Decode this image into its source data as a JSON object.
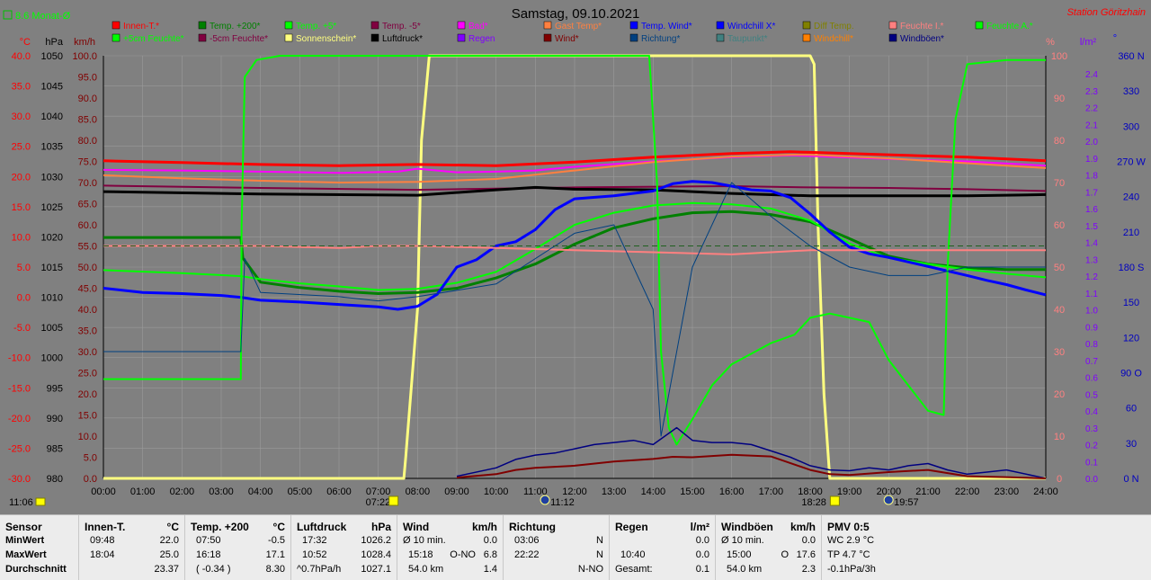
{
  "title": "Samstag, 09.10.2021",
  "station": "Station Göritzhain",
  "month_avg": "8.6 Monat-Ø",
  "axis_units": {
    "c": "°C",
    "hpa": "hPa",
    "kmh": "km/h",
    "pct": "%",
    "lm2": "l/m²",
    "deg": "°"
  },
  "legend": [
    {
      "label": "Innen-T.*",
      "color": "#ff0000"
    },
    {
      "label": "Temp. +200*",
      "color": "#008000"
    },
    {
      "label": "Temp. +5*",
      "color": "#00ff00"
    },
    {
      "label": "Temp. -5*",
      "color": "#800040"
    },
    {
      "label": "Bad*",
      "color": "#ff00ff"
    },
    {
      "label": "Gast Temp*",
      "color": "#ff8040"
    },
    {
      "label": "Temp. Wind*",
      "color": "#0000ff"
    },
    {
      "label": "Windchill X*",
      "color": "#0000ff"
    },
    {
      "label": "Diff Temp.",
      "color": "#808000"
    },
    {
      "label": "Feuchte I.*",
      "color": "#ff8080"
    },
    {
      "label": "Feuchte A.*",
      "color": "#00ff00"
    },
    {
      "label": "+5cm Feuchte*",
      "color": "#00ff00"
    },
    {
      "label": "-5cm Feuchte*",
      "color": "#800040"
    },
    {
      "label": "Sonnenschein*",
      "color": "#ffff80"
    },
    {
      "label": "Luftdruck*",
      "color": "#000000"
    },
    {
      "label": "Regen",
      "color": "#8000ff"
    },
    {
      "label": "Wind*",
      "color": "#800000"
    },
    {
      "label": "Richtung*",
      "color": "#004080"
    },
    {
      "label": "Taupunkt*",
      "color": "#408080"
    },
    {
      "label": "Windchill*",
      "color": "#ff8000"
    },
    {
      "label": "Windböen*",
      "color": "#000080"
    }
  ],
  "chart_data": {
    "type": "line",
    "title": "Samstag, 09.10.2021",
    "x_ticks": [
      "00:00",
      "01:00",
      "02:00",
      "03:00",
      "04:00",
      "05:00",
      "06:00",
      "07:00",
      "08:00",
      "09:00",
      "10:00",
      "11:00",
      "12:00",
      "13:00",
      "14:00",
      "15:00",
      "16:00",
      "17:00",
      "18:00",
      "19:00",
      "20:00",
      "21:00",
      "22:00",
      "23:00",
      "24:00"
    ],
    "y_axes": {
      "temp_c": [
        "40.0",
        "35.0",
        "30.0",
        "25.0",
        "20.0",
        "15.0",
        "10.0",
        "5.0",
        "0.0",
        "-5.0",
        "-10.0",
        "-15.0",
        "-20.0",
        "-25.0",
        "-30.0"
      ],
      "pressure_hpa": [
        "1050",
        "1045",
        "1040",
        "1035",
        "1030",
        "1025",
        "1020",
        "1015",
        "1010",
        "1005",
        "1000",
        "995",
        "990",
        "985",
        "980"
      ],
      "wind_kmh": [
        "100.0",
        "95.0",
        "90.0",
        "85.0",
        "80.0",
        "75.0",
        "70.0",
        "65.0",
        "60.0",
        "55.0",
        "50.0",
        "45.0",
        "40.0",
        "35.0",
        "30.0",
        "25.0",
        "20.0",
        "15.0",
        "10.0",
        "5.0",
        "0.0"
      ],
      "humidity_pct": [
        "100",
        "90",
        "80",
        "70",
        "60",
        "50",
        "40",
        "30",
        "20",
        "10",
        "0"
      ],
      "rain_lm2": [
        "2.4",
        "2.3",
        "2.2",
        "2.1",
        "2.0",
        "1.9",
        "1.8",
        "1.7",
        "1.6",
        "1.5",
        "1.4",
        "1.3",
        "1.2",
        "1.1",
        "1.0",
        "0.9",
        "0.8",
        "0.7",
        "0.6",
        "0.5",
        "0.4",
        "0.3",
        "0.2",
        "0.1",
        "0.0"
      ],
      "direction_deg": [
        "360 N",
        "330",
        "300",
        "270 W",
        "240",
        "210",
        "180 S",
        "150",
        "120",
        "90 O",
        "60",
        "30",
        "0 N"
      ]
    },
    "temp_range": [
      -30,
      40
    ],
    "pct_range": [
      0,
      100
    ],
    "series": [
      {
        "name": "Innen-T.*",
        "color": "#ff0000",
        "width": 3,
        "axis": "temp",
        "x": [
          0,
          2,
          4,
          6,
          8,
          10,
          12,
          14,
          16,
          17.5,
          18,
          20,
          22,
          24
        ],
        "y": [
          22.6,
          22.3,
          22.0,
          21.8,
          22.0,
          21.8,
          22.4,
          23.2,
          23.8,
          24.1,
          24.0,
          23.6,
          23.2,
          22.6
        ]
      },
      {
        "name": "Bad*",
        "color": "#ff00ff",
        "width": 2,
        "axis": "temp",
        "x": [
          0,
          2,
          4,
          6,
          7.5,
          8,
          9,
          10,
          11,
          12,
          14,
          16,
          17.5,
          18,
          20,
          22,
          24
        ],
        "y": [
          21.1,
          21.0,
          20.8,
          20.6,
          20.8,
          21.3,
          20.7,
          20.8,
          21.0,
          21.6,
          22.5,
          23.2,
          23.5,
          23.4,
          22.9,
          22.5,
          21.8
        ]
      },
      {
        "name": "Gast Temp*",
        "color": "#ff8040",
        "width": 2,
        "axis": "temp",
        "x": [
          0,
          2,
          4,
          6,
          8,
          10,
          12,
          14,
          16,
          17.5,
          18,
          20,
          22,
          24
        ],
        "y": [
          20.2,
          19.7,
          19.3,
          19.0,
          19.1,
          19.6,
          21.0,
          22.4,
          23.3,
          23.6,
          23.6,
          23.0,
          22.2,
          21.4
        ]
      },
      {
        "name": "Temp. -5*",
        "color": "#800040",
        "width": 2,
        "axis": "temp",
        "x": [
          0,
          4,
          8,
          12,
          16,
          18,
          20,
          22,
          24
        ],
        "y": [
          18.5,
          18.1,
          17.8,
          18.2,
          18.4,
          18.2,
          18.1,
          17.9,
          17.6
        ]
      },
      {
        "name": "Luftdruck*",
        "color": "#000000",
        "width": 3,
        "axis": "temp",
        "x": [
          0,
          4,
          8,
          10,
          11,
          12,
          14,
          16,
          18,
          20,
          22,
          24
        ],
        "y": [
          17.5,
          17.1,
          16.9,
          17.8,
          18.2,
          17.9,
          17.8,
          17.2,
          16.8,
          16.8,
          16.8,
          17.0
        ]
      },
      {
        "name": "Temp. +200*",
        "color": "#008000",
        "width": 3,
        "axis": "temp",
        "x": [
          0,
          3.5,
          3.55,
          4,
          5,
          6,
          7,
          8,
          9,
          10,
          11,
          12,
          13,
          14,
          15,
          16,
          17,
          18,
          19,
          20,
          21,
          22,
          23,
          24
        ],
        "y": [
          9.9,
          9.9,
          6.5,
          2.5,
          1.6,
          1.0,
          0.6,
          0.8,
          1.5,
          3.2,
          5.5,
          8.8,
          11.5,
          13.0,
          14.0,
          14.2,
          13.7,
          12.5,
          9.7,
          6.8,
          5.5,
          4.9,
          4.6,
          4.6
        ]
      },
      {
        "name": "Temp. +5*",
        "color": "#00ff00",
        "width": 2,
        "axis": "temp",
        "x": [
          0,
          2,
          3.5,
          4,
          5,
          6,
          7,
          8,
          9,
          10,
          11,
          12,
          13,
          14,
          15,
          16,
          17,
          18,
          19,
          20,
          21,
          22,
          23,
          24
        ],
        "y": [
          4.5,
          4.0,
          3.5,
          3.0,
          2.3,
          1.8,
          1.2,
          1.4,
          2.4,
          4.2,
          8.0,
          12.0,
          14.0,
          15.2,
          15.6,
          15.4,
          14.7,
          12.7,
          8.9,
          6.5,
          5.5,
          4.6,
          3.9,
          3.3
        ]
      },
      {
        "name": "Temp. Wind*",
        "color": "#0000ff",
        "width": 3,
        "axis": "temp",
        "x": [
          0,
          1,
          2,
          3,
          3.5,
          4,
          5,
          6,
          7,
          7.5,
          8,
          8.5,
          9,
          9.5,
          10,
          10.5,
          11,
          11.5,
          12,
          13,
          14,
          14.5,
          15,
          15.5,
          16,
          16.5,
          17,
          17.5,
          18,
          18.5,
          19,
          19.5,
          20,
          21,
          22,
          22.5,
          23,
          23.5,
          24
        ],
        "y": [
          1.5,
          0.8,
          0.6,
          0.3,
          0.0,
          -0.5,
          -0.8,
          -1.2,
          -1.6,
          -2.0,
          -1.5,
          0.5,
          5.0,
          6.2,
          8.5,
          9.2,
          11.2,
          14.5,
          16.3,
          16.8,
          17.6,
          18.8,
          19.2,
          19.0,
          18.4,
          17.8,
          17.6,
          16.5,
          13.8,
          10.8,
          8.3,
          7.2,
          6.6,
          5.1,
          3.6,
          2.8,
          2.1,
          1.2,
          0.4
        ]
      },
      {
        "name": "Feuchte A.*",
        "color": "#00ff00",
        "width": 2,
        "axis": "pct",
        "x": [
          0,
          3.5,
          3.52,
          3.6,
          3.9,
          4.5,
          7,
          7.5,
          10,
          13,
          13.9,
          14.1,
          14.2,
          14.4,
          14.6,
          15,
          15.5,
          16,
          17,
          17.6,
          18,
          18.5,
          19,
          19.5,
          20,
          21,
          21.4,
          21.5,
          21.7,
          22,
          23,
          24
        ],
        "y": [
          23.5,
          23.5,
          60,
          95,
          99,
          100,
          100,
          100,
          100,
          100,
          100,
          70,
          30,
          12,
          8,
          14,
          22,
          27,
          32,
          34,
          38,
          39,
          38,
          37,
          28,
          16,
          15,
          50,
          85,
          98,
          99,
          99
        ]
      },
      {
        "name": "Feuchte I.*",
        "color": "#ff8080",
        "width": 2,
        "axis": "pct",
        "x": [
          0,
          3,
          4,
          6,
          7,
          8,
          10,
          12,
          14,
          16,
          18,
          20,
          22,
          24
        ],
        "y": [
          55,
          55,
          55,
          54.5,
          55,
          55,
          54.5,
          54,
          53.5,
          53,
          54,
          54,
          54,
          54
        ]
      },
      {
        "name": "Richtung*",
        "color": "#004080",
        "width": 1,
        "axis": "pct",
        "x": [
          0,
          3.5,
          3.6,
          4,
          6,
          7,
          8,
          10,
          12,
          13,
          14,
          14.2,
          15,
          16,
          17,
          18,
          19,
          20,
          21,
          22,
          24
        ],
        "y": [
          30,
          30,
          52,
          44,
          43,
          42,
          43,
          46,
          58,
          60,
          40,
          10,
          50,
          70,
          62,
          55,
          50,
          48,
          48,
          50,
          50
        ]
      }
    ],
    "sun": {
      "name": "Sonnenschein*",
      "color": "#ffff80",
      "x": [
        0,
        7.65,
        7.7,
        8.0,
        8.1,
        8.3,
        18.0,
        18.1,
        18.2,
        18.35,
        18.5,
        24
      ],
      "y": [
        0,
        0,
        5,
        40,
        80,
        100,
        100,
        98,
        60,
        20,
        0,
        0
      ]
    },
    "wind": {
      "name": "Wind*",
      "color": "#800000",
      "x": [
        9,
        10,
        10.5,
        11,
        12,
        13,
        14,
        14.5,
        15,
        16,
        17,
        18,
        18.5,
        19,
        20,
        21,
        22,
        23,
        24
      ],
      "y": [
        0.2,
        1.0,
        2.0,
        2.5,
        3.0,
        4.0,
        4.6,
        5.1,
        5.0,
        5.6,
        5.2,
        2.0,
        1.0,
        0.8,
        1.5,
        2.0,
        0.5,
        0.3,
        0.0
      ]
    },
    "gust": {
      "name": "Windböen*",
      "color": "#000080",
      "x": [
        9,
        10,
        10.5,
        11,
        11.5,
        12,
        12.5,
        13,
        13.5,
        14,
        14.3,
        14.6,
        15,
        15.5,
        16,
        16.5,
        17,
        17.5,
        18,
        18.5,
        19,
        19.5,
        20,
        20.5,
        21,
        21.5,
        22,
        22.5,
        23,
        24
      ],
      "y": [
        0.5,
        2.5,
        4.5,
        5.5,
        6.0,
        7.0,
        8.0,
        8.5,
        9.0,
        8.0,
        10.0,
        12.0,
        9.0,
        8.5,
        8.5,
        8.0,
        6.5,
        5.0,
        3.0,
        2.0,
        1.8,
        2.5,
        2.0,
        3.0,
        3.5,
        2.0,
        1.0,
        1.5,
        2.0,
        0.0
      ]
    },
    "annotations": {
      "sunrise": "07:22",
      "sunset": "18:28",
      "moonrise": "11:12",
      "moonset": "19:57",
      "now": "11:06"
    }
  },
  "stats": {
    "sensor": {
      "h": "Sensor",
      "rows": [
        "MinWert",
        "MaxWert",
        "Durchschnitt"
      ]
    },
    "innen": {
      "h": "Innen-T.",
      "u": "°C",
      "rows": [
        [
          "09:48",
          "22.0"
        ],
        [
          "18:04",
          "25.0"
        ],
        [
          "",
          "23.37"
        ]
      ]
    },
    "temp200": {
      "h": "Temp. +200",
      "u": "°C",
      "rows": [
        [
          "07:50",
          "-0.5"
        ],
        [
          "16:18",
          "17.1"
        ],
        [
          "( -0.34 )",
          "8.30"
        ]
      ]
    },
    "luftdruck": {
      "h": "Luftdruck",
      "u": "hPa",
      "rows": [
        [
          "17:32",
          "1026.2"
        ],
        [
          "10:52",
          "1028.4"
        ],
        [
          "^0.7hPa/h",
          "1027.1"
        ]
      ]
    },
    "wind": {
      "h": "Wind",
      "u": "km/h",
      "rows": [
        [
          "Ø 10 min.",
          "",
          "0.0"
        ],
        [
          "15:18",
          "O-NO",
          "6.8"
        ],
        [
          "54.0 km",
          "",
          "1.4"
        ]
      ]
    },
    "richtung": {
      "h": "Richtung",
      "rows": [
        [
          "03:06",
          "N"
        ],
        [
          "22:22",
          "N"
        ],
        [
          "",
          "N-NO"
        ]
      ]
    },
    "regen": {
      "h": "Regen",
      "u": "l/m²",
      "rows": [
        [
          "",
          "0.0"
        ],
        [
          "10:40",
          "0.0"
        ],
        [
          "Gesamt:",
          "0.1"
        ]
      ]
    },
    "boeen": {
      "h": "Windböen",
      "u": "km/h",
      "rows": [
        [
          "Ø 10 min.",
          "",
          "0.0"
        ],
        [
          "15:00",
          "O",
          "17.6"
        ],
        [
          "54.0 km",
          "",
          "2.3"
        ]
      ]
    },
    "pmv": {
      "h": "PMV 0:5",
      "rows": [
        "WC 2.9 °C",
        "TP 4.7 °C",
        "-0.1hPa/3h"
      ]
    }
  }
}
